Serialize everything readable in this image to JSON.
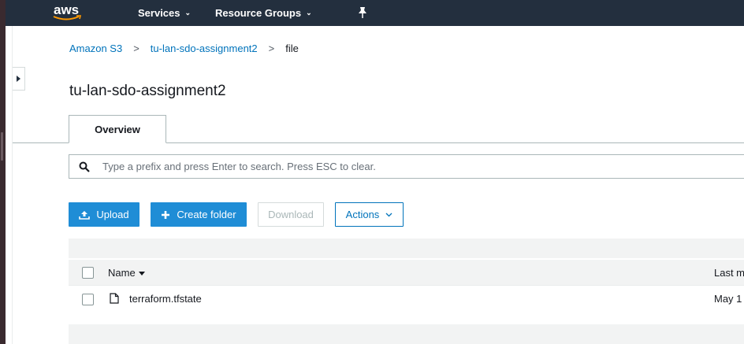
{
  "topbar": {
    "logo_text": "aws",
    "services_label": "Services",
    "resource_groups_label": "Resource Groups"
  },
  "breadcrumb": {
    "items": [
      "Amazon S3",
      "tu-lan-sdo-assignment2"
    ],
    "current": "file",
    "separator": ">"
  },
  "page": {
    "title": "tu-lan-sdo-assignment2"
  },
  "tabs": [
    {
      "label": "Overview",
      "active": true
    }
  ],
  "search": {
    "placeholder": "Type a prefix and press Enter to search. Press ESC to clear.",
    "value": ""
  },
  "toolbar": {
    "upload_label": "Upload",
    "create_folder_label": "Create folder",
    "download_label": "Download",
    "actions_label": "Actions"
  },
  "table": {
    "columns": [
      "Name",
      "Last m"
    ],
    "rows": [
      {
        "name": "terraform.tfstate",
        "last_modified": "May 1"
      }
    ]
  },
  "colors": {
    "topbar": "#232f3e",
    "primary": "#1f8dd6",
    "link": "#0073bb",
    "band": "#f2f3f3"
  },
  "icons": {
    "search": "search-icon",
    "upload": "upload-icon",
    "create_folder": "plus-icon",
    "actions": "chevron-down-icon",
    "file": "file-icon",
    "pin": "pin-icon"
  }
}
